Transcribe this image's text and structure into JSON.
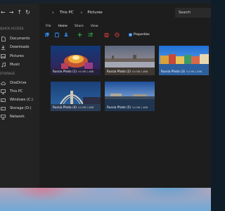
{
  "nav": {
    "back": "←",
    "forward": "→",
    "up": "↑",
    "refresh": "↻"
  },
  "sidebar": {
    "quick_access_label": "QUICK ACCESS",
    "quick_items": [
      {
        "label": "Documents",
        "icon": "document-icon"
      },
      {
        "label": "Downloads",
        "icon": "download-icon"
      },
      {
        "label": "Pictures",
        "icon": "picture-icon"
      },
      {
        "label": "Music",
        "icon": "music-icon"
      }
    ],
    "storage_label": "STORAGE",
    "storage_items": [
      {
        "label": "OneDrive",
        "icon": "cloud-icon"
      },
      {
        "label": "This PC",
        "icon": "computer-icon"
      },
      {
        "label": "Windows (C:)",
        "icon": "drive-icon"
      },
      {
        "label": "Storage (D:)",
        "icon": "drive-icon"
      },
      {
        "label": "Network",
        "icon": "network-icon"
      }
    ]
  },
  "breadcrumb": [
    "This PC",
    "Pictures"
  ],
  "search": {
    "label": "Search"
  },
  "tabs": [
    "File",
    "Home",
    "Share",
    "View"
  ],
  "active_tab": "Home",
  "toolbar": {
    "properties_label": "Properties"
  },
  "files": [
    {
      "name": "Russia Photo (1)",
      "meta": "9.0 MB  1.4MB"
    },
    {
      "name": "Russia Photo (2)",
      "meta": "9.0 MB  1.4MB"
    },
    {
      "name": "Russia Photo (3)",
      "meta": "9.0 MB  1.4MB"
    },
    {
      "name": "Russia Photo (4)",
      "meta": "9.0 MB  1.4MB"
    },
    {
      "name": "Russia Photo (5)",
      "meta": "9.0 MB  1.4MB"
    }
  ],
  "colors": {
    "accent": "#2f8ef0",
    "add_green": "#2db34a",
    "delete_red": "#d23a3a",
    "window_bg": "#1f1f1f"
  }
}
